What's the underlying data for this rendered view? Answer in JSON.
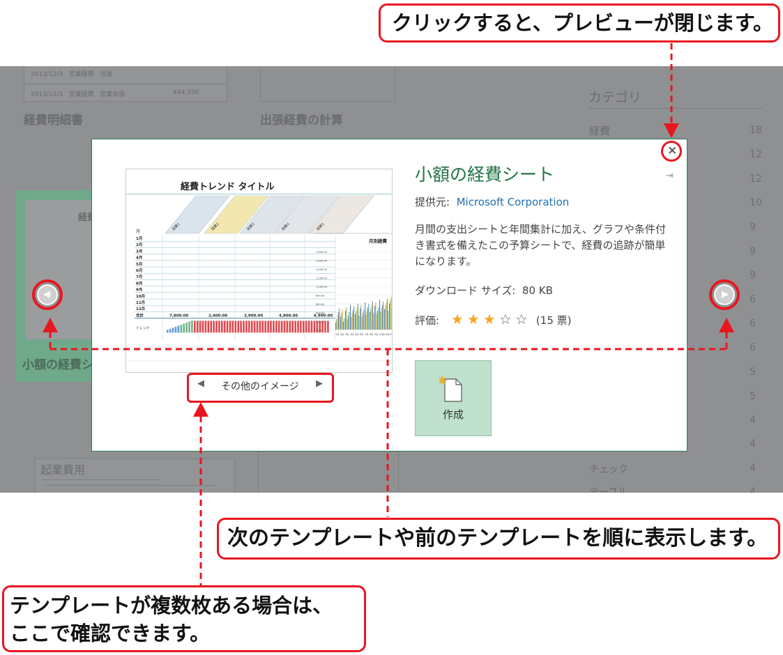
{
  "callouts": {
    "close": "クリックすると、プレビューが閉じます。",
    "nav": "次のテンプレートや前のテンプレートを順に表示します。",
    "images_line1": "テンプレートが複数枚ある場合は、",
    "images_line2": "ここで確認できます。"
  },
  "background": {
    "left_template_title": "経費明細書",
    "center_template_title": "出張経費の計算",
    "highlight_template_title": "小額の経費シ",
    "highlight_thumb_title": "経費",
    "bottom_template_title": "起業費用",
    "left_thumb_rows": [
      {
        "date": "2013/12/3",
        "name": "営業経費",
        "kind": "出張"
      },
      {
        "date": "2013/12/3",
        "name": "営業経費",
        "kind": "営業出張",
        "amount": "¥44,550"
      }
    ],
    "category_header": "カテゴリ",
    "categories": [
      {
        "name": "経費",
        "count": "18"
      },
      {
        "name": "",
        "count": "12"
      },
      {
        "name": "",
        "count": "12"
      },
      {
        "name": "",
        "count": "10"
      },
      {
        "name": "",
        "count": "9"
      },
      {
        "name": "",
        "count": "9"
      },
      {
        "name": "",
        "count": "9"
      },
      {
        "name": "",
        "count": "6"
      },
      {
        "name": "",
        "count": "6"
      },
      {
        "name": "",
        "count": "6"
      },
      {
        "name": "",
        "count": "5"
      },
      {
        "name": "",
        "count": "5"
      },
      {
        "name": "",
        "count": "4"
      },
      {
        "name": "",
        "count": "4"
      },
      {
        "name": "チェック",
        "count": "4"
      },
      {
        "name": "テーブル",
        "count": "4"
      }
    ]
  },
  "modal": {
    "title": "小額の経費シート",
    "provider_label": "提供元:",
    "provider_value": "Microsoft Corporation",
    "description": "月間の支出シートと年間集計に加え、グラフや条件付き書式を備えたこの予算シートで、経費の追跡が簡単になります。",
    "download_label": "ダウンロード サイズ:",
    "download_value": "80 KB",
    "rating_label": "評価:",
    "rating_value": 3,
    "rating_max": 5,
    "rating_count": "(15 票)",
    "create_label": "作成",
    "more_images_label": "その他のイメージ",
    "accent_color": "#217346",
    "star_color": "#f5a623"
  },
  "preview": {
    "sheet_title": "経費トレンド タイトル",
    "chart_title": "月別経費",
    "month_header": "月",
    "column_headers": [
      "経費1",
      "経費2",
      "経費3",
      "経費4",
      "経費5"
    ],
    "months": [
      "1月",
      "2月",
      "3月",
      "4月",
      "5月",
      "6月",
      "7月",
      "8月",
      "9月",
      "10月",
      "11月",
      "12月"
    ],
    "total_label": "合計",
    "totals": [
      "7,800.00",
      "2,400.00",
      "3,900.00",
      "4,800.00",
      "6,900.00"
    ],
    "trend_label": "トレンド",
    "y_ticks": [
      "1,800.00",
      "1,600.00",
      "1,400.00",
      "1,200.00",
      "1,000.00",
      "800.00",
      "600.00",
      "400.00",
      "200.00",
      "0.00"
    ],
    "x_ticks": [
      "1月",
      "2月",
      "3月",
      "4月",
      "5月",
      "6月",
      "7月",
      "8月",
      "9月",
      "10月",
      "11月",
      "12月"
    ]
  }
}
